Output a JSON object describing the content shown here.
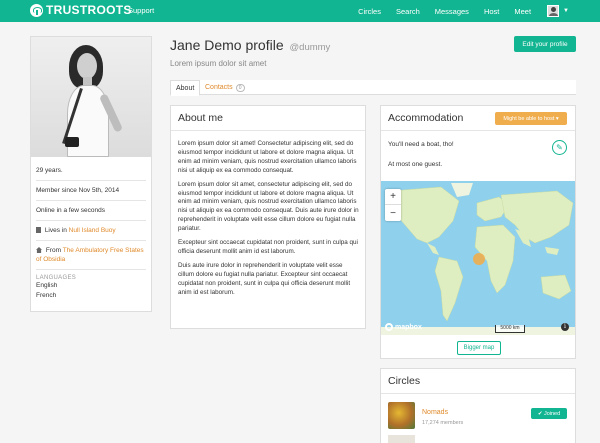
{
  "nav": {
    "brand": "TRUSTROOTS",
    "support": "Support",
    "items": [
      "Circles",
      "Search",
      "Messages",
      "Host",
      "Meet"
    ]
  },
  "profile": {
    "name": "Jane Demo profile",
    "username": "@dummy",
    "tagline": "Lorem ipsum dolor sit amet",
    "edit_label": "Edit your profile"
  },
  "tabs": {
    "about": "About",
    "contacts": "Contacts",
    "contacts_count": "0"
  },
  "sidebar": {
    "age": "29 years.",
    "member_since": "Member since Nov 5th, 2014",
    "online": "Online in a few seconds",
    "lives_prefix": "Lives in",
    "lives_place": "Null Island Buoy",
    "from_prefix": "From",
    "from_place": "The Ambulatory Free States of Obsidia",
    "languages_heading": "LANGUAGES",
    "languages": [
      "English",
      "French"
    ]
  },
  "about": {
    "title": "About me",
    "paragraphs": [
      "Lorem ipsum dolor sit amet! Consectetur adipiscing elit, sed do eiusmod tempor incididunt ut labore et dolore magna aliqua. Ut enim ad minim veniam, quis nostrud exercitation ullamco laboris nisi ut aliquip ex ea commodo consequat.",
      "Lorem ipsum dolor sit amet, consectetur adipiscing elit, sed do eiusmod tempor incididunt ut labore et dolore magna aliqua. Ut enim ad minim veniam, quis nostrud exercitation ullamco laboris nisi ut aliquip ex ea commodo consequat. Duis aute irure dolor in reprehenderit in voluptate velit esse cillum dolore eu fugiat nulla pariatur.",
      "Excepteur sint occaecat cupidatat non proident, sunt in culpa qui officia deserunt mollit anim id est laborum.",
      "Duis aute irure dolor in reprehenderit in voluptate velit esse cillum dolore eu fugiat nulla pariatur. Excepteur sint occaecat cupidatat non proident, sunt in culpa qui officia deserunt mollit anim id est laborum."
    ]
  },
  "accommodation": {
    "title": "Accommodation",
    "status_button": "Might be able to host ▾",
    "line1": "You'll need a boat, tho!",
    "line2": "At most one guest.",
    "zoom_in": "+",
    "zoom_out": "−",
    "map_attribution": "mapbox",
    "scale": "5000 km",
    "info": "i",
    "bigger_map": "Bigger map",
    "colors": {
      "water": "#8fd0ec",
      "land": "#dfeec0",
      "marker": "#f0ad4e"
    }
  },
  "circles": {
    "title": "Circles",
    "items": [
      {
        "name": "Nomads",
        "members": "17,274 members",
        "status": "✔ Joined"
      }
    ]
  },
  "colors": {
    "brand": "#12b591",
    "accent": "#e08a2b"
  }
}
